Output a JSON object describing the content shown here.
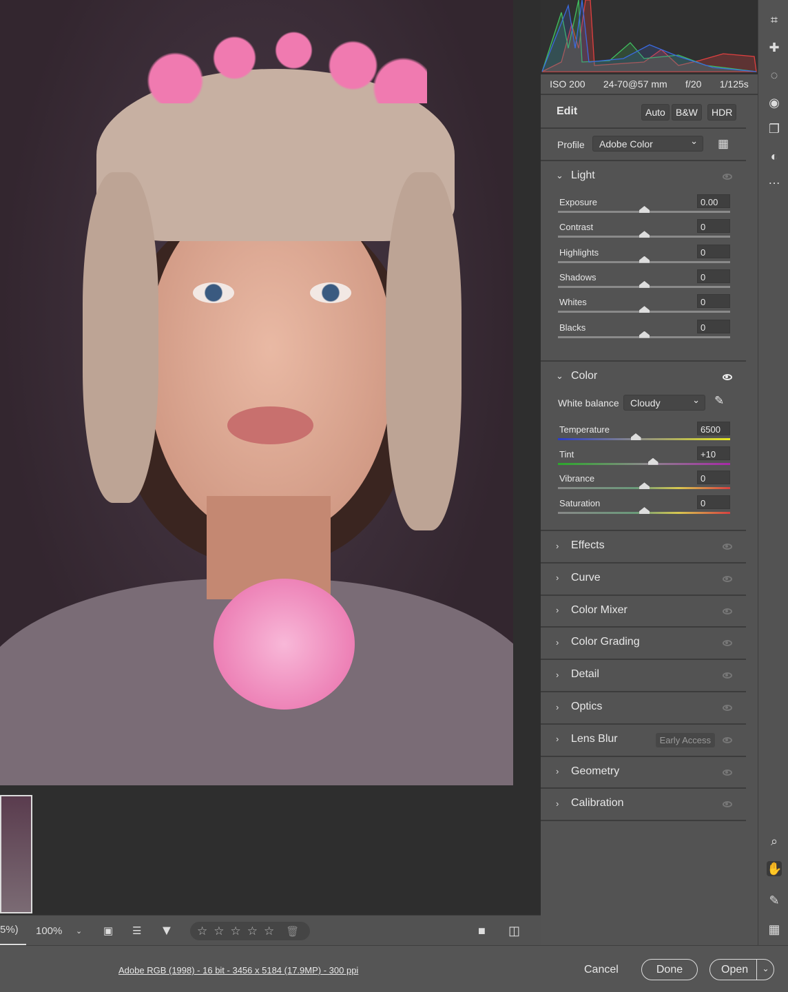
{
  "histogram": {
    "iso": "ISO 200",
    "lens": "24-70@57 mm",
    "aperture": "f/20",
    "shutter": "1/125s"
  },
  "edit": {
    "title": "Edit",
    "auto": "Auto",
    "bw": "B&W",
    "hdr": "HDR"
  },
  "profile": {
    "label": "Profile",
    "value": "Adobe Color"
  },
  "light": {
    "title": "Light",
    "sliders": [
      {
        "label": "Exposure",
        "value": "0.00",
        "position": 0.5
      },
      {
        "label": "Contrast",
        "value": "0",
        "position": 0.5
      },
      {
        "label": "Highlights",
        "value": "0",
        "position": 0.5
      },
      {
        "label": "Shadows",
        "value": "0",
        "position": 0.5
      },
      {
        "label": "Whites",
        "value": "0",
        "position": 0.5
      },
      {
        "label": "Blacks",
        "value": "0",
        "position": 0.5
      }
    ]
  },
  "color": {
    "title": "Color",
    "wb_label": "White balance",
    "wb_value": "Cloudy",
    "sliders": [
      {
        "label": "Temperature",
        "value": "6500",
        "position": 0.45,
        "gradient": "linear-gradient(90deg,#2a3cc8,#8a8a8a 45%,#e8e820)"
      },
      {
        "label": "Tint",
        "value": "+10",
        "position": 0.55,
        "gradient": "linear-gradient(90deg,#2aa82a,#8a8a8a 50%,#a828a8)"
      },
      {
        "label": "Vibrance",
        "value": "0",
        "position": 0.5,
        "gradient": "linear-gradient(90deg,#888,#6a9a7a 45%,#d8c850 70%,#d84040)"
      },
      {
        "label": "Saturation",
        "value": "0",
        "position": 0.5,
        "gradient": "linear-gradient(90deg,#888,#6a9a7a 45%,#d8c850 70%,#d84040)"
      }
    ]
  },
  "sections": [
    {
      "title": "Effects"
    },
    {
      "title": "Curve"
    },
    {
      "title": "Color Mixer"
    },
    {
      "title": "Color Grading"
    },
    {
      "title": "Detail"
    },
    {
      "title": "Optics"
    },
    {
      "title": "Lens Blur",
      "badge": "Early Access"
    },
    {
      "title": "Geometry"
    },
    {
      "title": "Calibration"
    }
  ],
  "toolbar": {
    "zoom_partial": "5%)",
    "zoom": "100%"
  },
  "status": {
    "info": "Adobe RGB (1998) - 16 bit - 3456 x 5184 (17.9MP) - 300 ppi",
    "cancel": "Cancel",
    "done": "Done",
    "open": "Open"
  },
  "tools": [
    "crop-icon",
    "healing-icon",
    "masking-icon",
    "redeye-icon",
    "snapshots-icon",
    "presets-icon",
    "more-icon",
    "zoom-icon",
    "hand-icon",
    "sampler-icon",
    "grid-icon"
  ]
}
